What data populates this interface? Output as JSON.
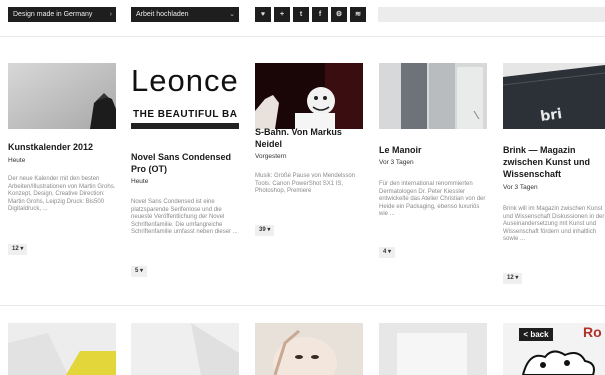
{
  "toolbar": {
    "filter_label": "Design made in Germany",
    "upload_label": "Arbeit hochladen",
    "social_icons": [
      "heart-icon",
      "plus-icon",
      "twitter-icon",
      "facebook-icon",
      "rss-gear-icon",
      "rss-icon"
    ],
    "social_glyphs": [
      "♥",
      "+",
      "t",
      "f",
      "⚙",
      "≋"
    ],
    "search_placeholder": ""
  },
  "cards": [
    {
      "title": "Kunstkalender 2012",
      "date": "Heute",
      "desc": "Der neue Kalender mit den besten Arbeiten/Illustrationen von Martin Grohs. Konzept, Design, Creative Direction: Martin Grohs, Leipzig Druck: Bis500 Digitaldruck, ...",
      "count": "12"
    },
    {
      "title": "Novel Sans Condensed Pro (OT)",
      "date": "Heute",
      "desc": "Novel Sans Condensed ist eine platzsparende Serifenlose und die neueste Veröffentlichung der Novel Schriftenfamilie. Die umfangreiche Schriftenfamilie umfasst neben dieser ...",
      "count": "5",
      "thumb_word": "Leonce",
      "thumb_sub": "THE BEAUTIFUL BA"
    },
    {
      "title": "S-Bahn. Von Markus Neidel",
      "date": "Vorgestern",
      "desc": "Musik: Große Pause von Mendelsson Tools: Canon PowerShot SX1 IS, Photoshop, Premiere",
      "count": "39"
    },
    {
      "title": "Le Manoir",
      "date": "Vor 3 Tagen",
      "desc": "Für den international renommierten Dermatologen Dr. Peter Kiessler entwickelte das Atelier Christian von der Heide ein Packaging, ebenso luxuriös wie ...",
      "count": "4"
    },
    {
      "title": "Brink — Magazin zwischen Kunst und Wissenschaft",
      "date": "Vor 3 Tagen",
      "desc": "Brink will im Magazin zwischen Kunst und Wissenschaft Diskussionen in der Auseinandersetzung mit Kunst und Wissenschaft fördern und inhaltlich sowie ...",
      "count": "12"
    }
  ],
  "bottom_row": {
    "back_label": "< back",
    "logo_fragment": "Ro"
  },
  "colors": {
    "dark_bar": "#1e1e1e",
    "badge_bg": "#efefef",
    "desc_text": "#8a8a8a"
  }
}
